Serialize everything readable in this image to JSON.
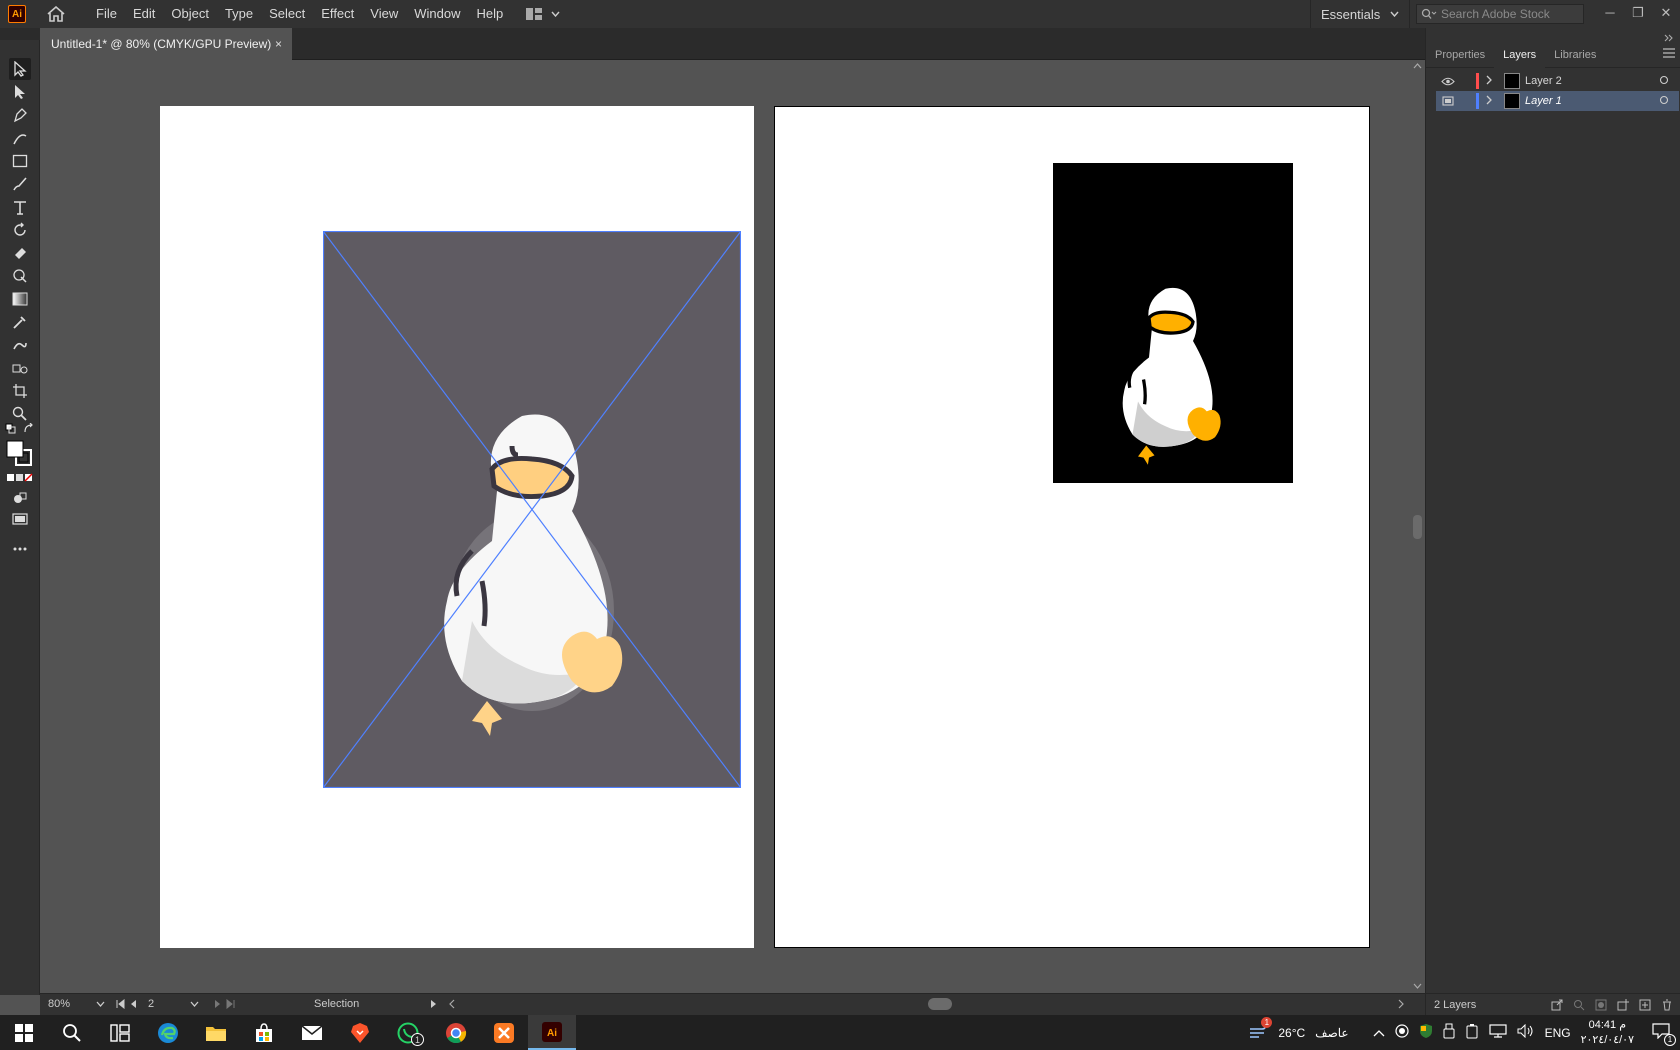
{
  "app": {
    "logo": "Ai",
    "menus": [
      "File",
      "Edit",
      "Object",
      "Type",
      "Select",
      "Effect",
      "View",
      "Window",
      "Help"
    ]
  },
  "workspace": {
    "label": "Essentials"
  },
  "search": {
    "placeholder": "Search Adobe Stock"
  },
  "document": {
    "tab_title": "Untitled-1* @ 80% (CMYK/GPU Preview)",
    "close": "×"
  },
  "panel": {
    "tabs": [
      "Properties",
      "Layers",
      "Libraries"
    ],
    "layers": [
      {
        "name": "Layer 2",
        "color": "#ff4d4d"
      },
      {
        "name": "Layer 1",
        "color": "#4f80ff"
      }
    ],
    "footer": "2 Layers"
  },
  "status": {
    "zoom": "80%",
    "artboard": "2",
    "tool": "Selection"
  },
  "tray": {
    "weather": "26°C",
    "weather_text": "عاصف",
    "lang": "ENG",
    "time": "04:41 م",
    "date": "٢٠٢٤/٠٤/٠٧",
    "notif_count": "1",
    "whatsapp_badge": "1"
  },
  "colors": {
    "accent": "#ff9a00",
    "selection": "#4f80ff"
  }
}
